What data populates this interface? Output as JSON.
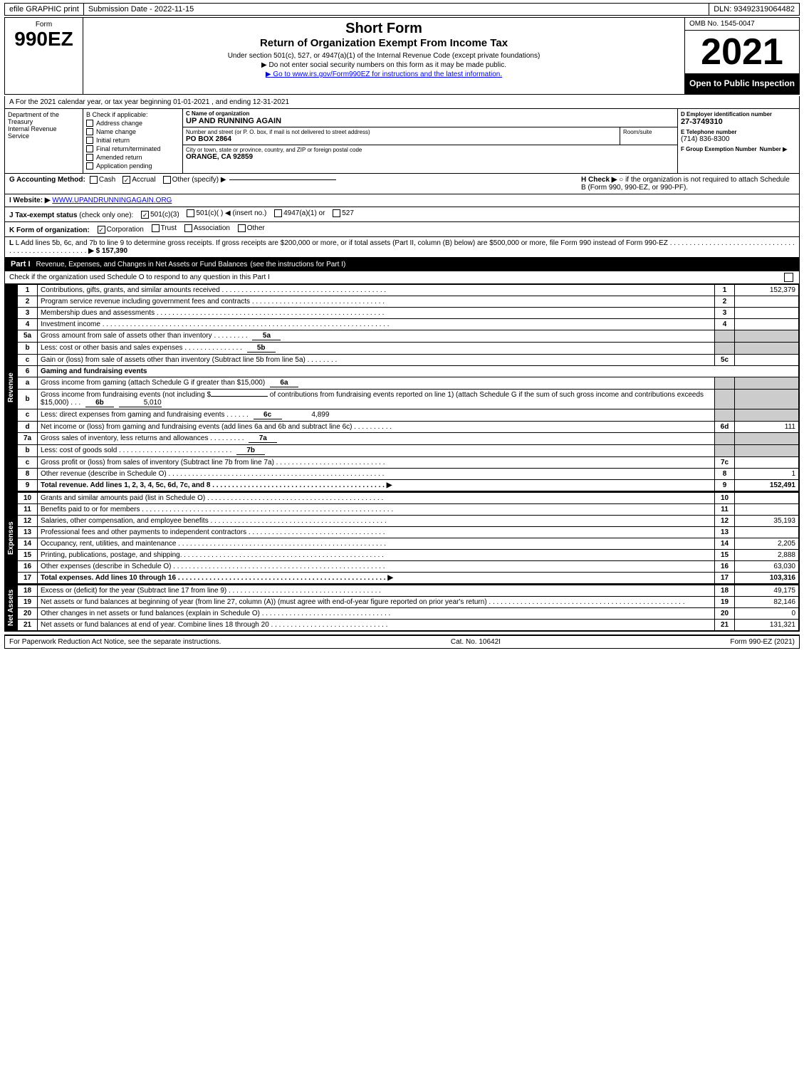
{
  "topbar": {
    "efile": "efile GRAPHIC print",
    "submission": "Submission Date - 2022-11-15",
    "dln": "DLN: 93492319064482"
  },
  "header": {
    "form_label": "Form",
    "form_number": "990EZ",
    "short_form": "Short Form",
    "return_title": "Return of Organization Exempt From Income Tax",
    "subtitle": "Under section 501(c), 527, or 4947(a)(1) of the Internal Revenue Code (except private foundations)",
    "notice1": "▶ Do not enter social security numbers on this form as it may be made public.",
    "notice2": "▶ Go to www.irs.gov/Form990EZ for instructions and the latest information.",
    "omb": "OMB No. 1545-0047",
    "year": "2021",
    "open_to_public": "Open to Public Inspection"
  },
  "dept": {
    "name": "Department of the Treasury",
    "sub": "Internal Revenue Service"
  },
  "checkboxes": {
    "title": "B Check if applicable:",
    "items": [
      {
        "label": "Address change",
        "checked": false
      },
      {
        "label": "Name change",
        "checked": false
      },
      {
        "label": "Initial return",
        "checked": false
      },
      {
        "label": "Final return/terminated",
        "checked": false
      },
      {
        "label": "Amended return",
        "checked": false
      },
      {
        "label": "Application pending",
        "checked": false
      }
    ]
  },
  "org": {
    "c_label": "C Name of organization",
    "name": "UP AND RUNNING AGAIN",
    "address_label": "Number and street (or P. O. box, if mail is not delivered to street address)",
    "address": "PO BOX 2864",
    "room_label": "Room/suite",
    "room": "",
    "city_label": "City or town, state or province, country, and ZIP or foreign postal code",
    "city": "ORANGE, CA  92859",
    "d_label": "D Employer identification number",
    "ein": "27-3749310",
    "e_label": "E Telephone number",
    "phone": "(714) 836-8300",
    "f_label": "F Group Exemption Number",
    "group_exemption": ""
  },
  "year_line": {
    "text": "A  For the 2021 calendar year, or tax year beginning  01-01-2021 , and ending  12-31-2021"
  },
  "accounting": {
    "g_label": "G Accounting Method:",
    "cash": "Cash",
    "accrual": "Accrual",
    "accrual_checked": true,
    "other": "Other (specify) ▶",
    "h_label": "H  Check ▶",
    "h_text": "○ if the organization is not required to attach Schedule B (Form 990, 990-EZ, or 990-PF)."
  },
  "website": {
    "i_label": "I Website: ▶",
    "url": "WWW.UPANDRUNNINGAGAIN.ORG"
  },
  "tax_exempt": {
    "j_label": "J Tax-exempt status",
    "note": "(check only one):",
    "options": [
      {
        "label": "501(c)(3)",
        "checked": true
      },
      {
        "label": "501(c)(  ) ◀ (insert no.)",
        "checked": false
      },
      {
        "label": "4947(a)(1) or",
        "checked": false
      },
      {
        "label": "527",
        "checked": false
      }
    ]
  },
  "form_org": {
    "k_label": "K Form of organization:",
    "options": [
      {
        "label": "Corporation",
        "checked": true
      },
      {
        "label": "Trust",
        "checked": false
      },
      {
        "label": "Association",
        "checked": false
      },
      {
        "label": "Other",
        "checked": false
      }
    ]
  },
  "l_line": {
    "text": "L Add lines 5b, 6c, and 7b to line 9 to determine gross receipts. If gross receipts are $200,000 or more, or if total assets (Part II, column (B) below) are $500,000 or more, file Form 990 instead of Form 990-EZ",
    "value": "$ 157,390"
  },
  "part1": {
    "title": "Part I",
    "subtitle": "Revenue, Expenses, and Changes in Net Assets or Fund Balances",
    "see_instructions": "(see the instructions for Part I)",
    "check_line": "Check if the organization used Schedule O to respond to any question in this Part I",
    "rows": [
      {
        "num": "1",
        "desc": "Contributions, gifts, grants, and similar amounts received",
        "line": "1",
        "value": "152,379",
        "dots": true
      },
      {
        "num": "2",
        "desc": "Program service revenue including government fees and contracts",
        "line": "2",
        "value": "",
        "dots": true
      },
      {
        "num": "3",
        "desc": "Membership dues and assessments",
        "line": "3",
        "value": "",
        "dots": true
      },
      {
        "num": "4",
        "desc": "Investment income",
        "line": "4",
        "value": "",
        "dots": true
      },
      {
        "num": "5a",
        "desc": "Gross amount from sale of assets other than inventory",
        "sub": "5a",
        "value": "",
        "dots": true
      },
      {
        "num": "b",
        "desc": "Less: cost or other basis and sales expenses",
        "sub": "5b",
        "value": "",
        "dots": true
      },
      {
        "num": "c",
        "desc": "Gain or (loss) from sale of assets other than inventory (Subtract line 5b from line 5a)",
        "line": "5c",
        "value": "",
        "dots": true
      },
      {
        "num": "6",
        "desc": "Gaming and fundraising events",
        "header": true
      },
      {
        "num": "a",
        "desc": "Gross income from gaming (attach Schedule G if greater than $15,000)",
        "sub": "6a",
        "value": ""
      },
      {
        "num": "b",
        "desc": "Gross income from fundraising events (not including $_____ of contributions from fundraising events reported on line 1) (attach Schedule G if the sum of such gross income and contributions exceeds $15,000)",
        "sub": "6b",
        "value": "5,010",
        "dots": true
      },
      {
        "num": "c",
        "desc": "Less: direct expenses from gaming and fundraising events",
        "sub": "6c",
        "value": "4,899",
        "dots": true
      },
      {
        "num": "d",
        "desc": "Net income or (loss) from gaming and fundraising events (add lines 6a and 6b and subtract line 6c)",
        "line": "6d",
        "value": "111",
        "dots": true
      },
      {
        "num": "7a",
        "desc": "Gross sales of inventory, less returns and allowances",
        "sub": "7a",
        "value": "",
        "dots": true
      },
      {
        "num": "b",
        "desc": "Less: cost of goods sold",
        "sub": "7b",
        "value": "",
        "dots": true
      },
      {
        "num": "c",
        "desc": "Gross profit or (loss) from sales of inventory (Subtract line 7b from line 7a)",
        "line": "7c",
        "value": "",
        "dots": true
      },
      {
        "num": "8",
        "desc": "Other revenue (describe in Schedule O)",
        "line": "8",
        "value": "1",
        "dots": true
      },
      {
        "num": "9",
        "desc": "Total revenue. Add lines 1, 2, 3, 4, 5c, 6d, 7c, and 8",
        "line": "9",
        "value": "152,491",
        "dots": true,
        "bold": true,
        "arrow": true
      }
    ],
    "expenses_rows": [
      {
        "num": "10",
        "desc": "Grants and similar amounts paid (list in Schedule O)",
        "line": "10",
        "value": "",
        "dots": true
      },
      {
        "num": "11",
        "desc": "Benefits paid to or for members",
        "line": "11",
        "value": "",
        "dots": true
      },
      {
        "num": "12",
        "desc": "Salaries, other compensation, and employee benefits",
        "line": "12",
        "value": "35,193",
        "dots": true
      },
      {
        "num": "13",
        "desc": "Professional fees and other payments to independent contractors",
        "line": "13",
        "value": "",
        "dots": true
      },
      {
        "num": "14",
        "desc": "Occupancy, rent, utilities, and maintenance",
        "line": "14",
        "value": "2,205",
        "dots": true
      },
      {
        "num": "15",
        "desc": "Printing, publications, postage, and shipping",
        "line": "15",
        "value": "2,888",
        "dots": true
      },
      {
        "num": "16",
        "desc": "Other expenses (describe in Schedule O)",
        "line": "16",
        "value": "63,030",
        "dots": true
      },
      {
        "num": "17",
        "desc": "Total expenses. Add lines 10 through 16",
        "line": "17",
        "value": "103,316",
        "dots": true,
        "bold": true,
        "arrow": true
      }
    ],
    "assets_rows": [
      {
        "num": "18",
        "desc": "Excess or (deficit) for the year (Subtract line 17 from line 9)",
        "line": "18",
        "value": "49,175",
        "dots": true
      },
      {
        "num": "19",
        "desc": "Net assets or fund balances at beginning of year (from line 27, column (A)) (must agree with end-of-year figure reported on prior year's return)",
        "line": "19",
        "value": "82,146",
        "dots": true
      },
      {
        "num": "20",
        "desc": "Other changes in net assets or fund balances (explain in Schedule O)",
        "line": "20",
        "value": "0",
        "dots": true
      },
      {
        "num": "21",
        "desc": "Net assets or fund balances at end of year. Combine lines 18 through 20",
        "line": "21",
        "value": "131,321",
        "dots": true
      }
    ]
  },
  "footer": {
    "left": "For Paperwork Reduction Act Notice, see the separate instructions.",
    "cat": "Cat. No. 10642I",
    "right": "Form 990-EZ (2021)"
  }
}
